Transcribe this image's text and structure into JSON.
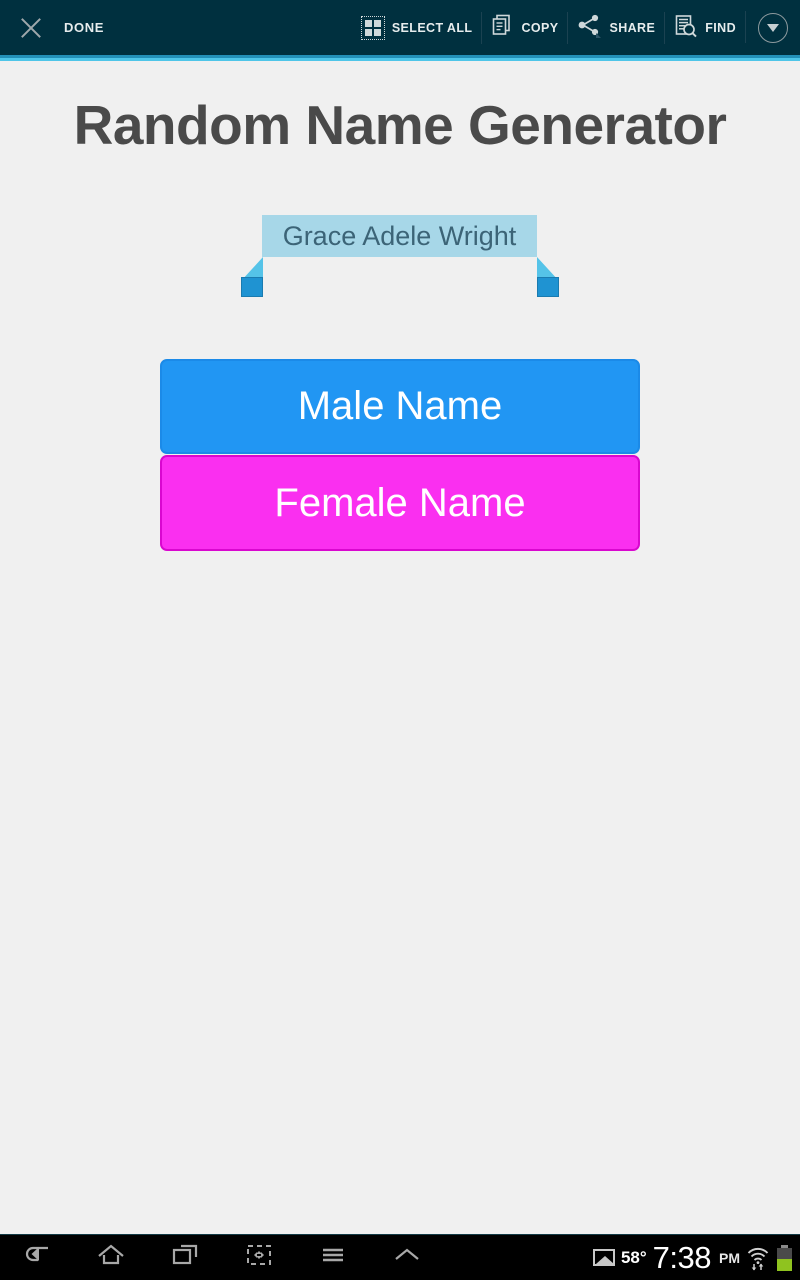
{
  "context_action_bar": {
    "close_icon": "close-icon",
    "done_label": "DONE",
    "actions": [
      {
        "icon": "select-all-icon",
        "label": "SELECT ALL"
      },
      {
        "icon": "copy-icon",
        "label": "COPY"
      },
      {
        "icon": "share-icon",
        "label": "SHARE"
      },
      {
        "icon": "find-icon",
        "label": "FIND"
      }
    ],
    "overflow_icon": "circle-chevron-down-icon",
    "background_color": "#00303f",
    "accent_colors": [
      "#2390b8",
      "#4ec5e8"
    ]
  },
  "main": {
    "title": "Random Name Generator",
    "title_color": "#4a4a4a",
    "background_color": "#f0f0f0",
    "result": {
      "text": "Grace Adele Wright",
      "selected": true,
      "selection_color": "#a7d7e8",
      "text_color": "#3c6477",
      "left_handle_icon": "selection-handle-left-icon",
      "right_handle_icon": "selection-handle-right-icon"
    },
    "buttons": [
      {
        "label": "Male Name",
        "color": "#2196f3",
        "border_color": "#1b8ae8"
      },
      {
        "label": "Female Name",
        "color": "#fa2ff0",
        "border_color": "#d907cf"
      }
    ]
  },
  "navbar": {
    "background_color": "#000000",
    "buttons": [
      {
        "icon": "back-icon"
      },
      {
        "icon": "home-icon"
      },
      {
        "icon": "recent-apps-icon"
      },
      {
        "icon": "screenshot-icon"
      },
      {
        "icon": "menu-icon"
      },
      {
        "icon": "chevron-up-icon"
      }
    ],
    "status": {
      "gallery_icon": "gallery-icon",
      "temperature": "58°",
      "time": "7:38",
      "meridiem": "PM",
      "wifi_icon": "wifi-data-icon",
      "battery_icon": "battery-half-icon",
      "battery_level_percent": 50,
      "battery_color": "#8fc31f"
    }
  }
}
